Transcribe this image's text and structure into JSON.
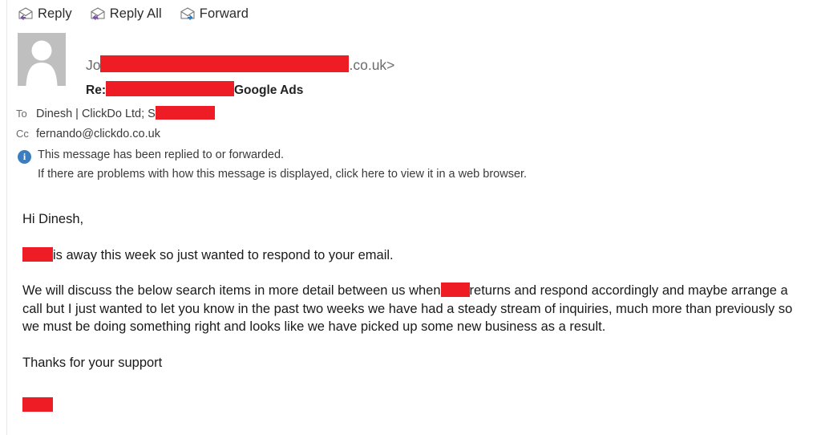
{
  "colors": {
    "redaction": "#ee1c25",
    "reply_arrow": "#7a52a8",
    "forward_arrow": "#1f7fd0",
    "info_badge": "#3a7ebf",
    "avatar_bg": "#bfbfbf"
  },
  "toolbar": {
    "buttons": [
      {
        "label": "Reply",
        "icon": "reply-envelope-icon"
      },
      {
        "label": "Reply All",
        "icon": "reply-all-envelope-icon"
      },
      {
        "label": "Forward",
        "icon": "forward-envelope-icon"
      }
    ]
  },
  "header": {
    "avatar_icon": "person-placeholder-icon",
    "sender_prefix": "Jo",
    "sender_suffix": ".co.uk>",
    "subject_prefix": "Re:",
    "subject_suffix": "Google Ads",
    "to_label": "To",
    "to_value": "Dinesh | ClickDo Ltd; S",
    "cc_label": "Cc",
    "cc_value": "fernando@clickdo.co.uk"
  },
  "notice": {
    "icon": "info-icon",
    "badge_glyph": "i",
    "line1": "This message has been replied to or forwarded.",
    "line2": "If there are problems with how this message is displayed, click here to view it in a web browser."
  },
  "message": {
    "greeting": "Hi Dinesh,",
    "p1_after_redaction": "is away this week so just wanted to respond to your email.",
    "p2_before_redaction": "We will discuss the below search items in more detail between us when",
    "p2_after_redaction": "returns and respond accordingly and maybe arrange a call but I just wanted to let you know in the past two weeks we have had a steady stream of inquiries, much more than previously so we must be doing something right and looks like we have picked up some new business as a result.",
    "closing": "Thanks for your support"
  }
}
